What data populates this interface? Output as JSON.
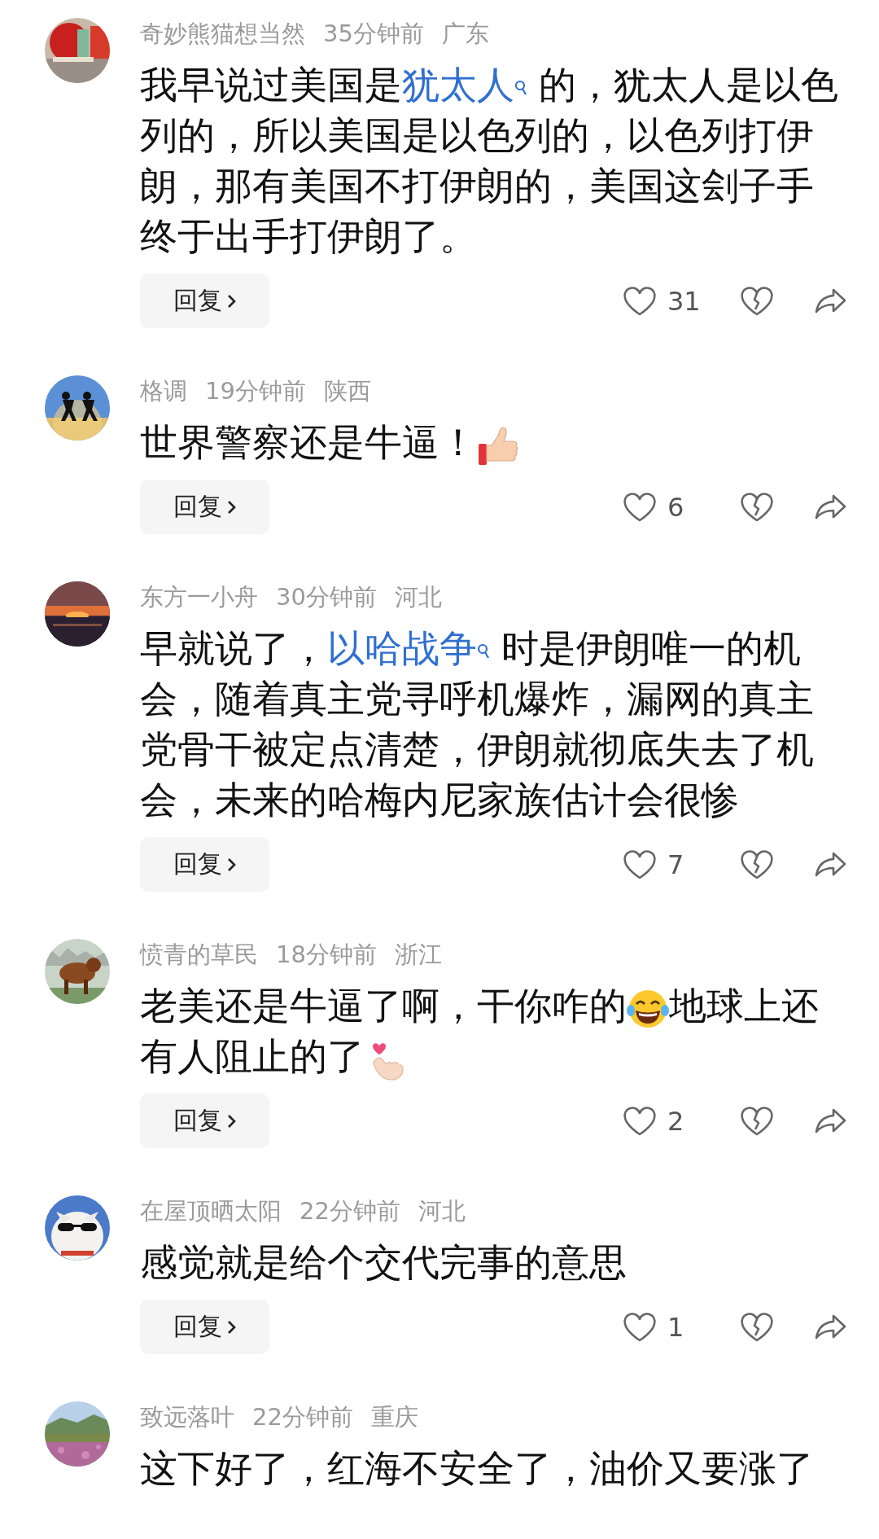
{
  "comments": [
    {
      "user": "奇妙熊猫想当然",
      "time": "35分钟前",
      "location": "广东",
      "body": [
        {
          "kind": "text",
          "text": "我早说过美国是"
        },
        {
          "kind": "link",
          "text": "犹太人"
        },
        {
          "kind": "text",
          "text": " 的，犹太人是以色列的，所以美国是以色列的，以色列打伊朗，那有美国不打伊朗的，美国这刽子手终于出手打伊朗了。"
        }
      ],
      "reply": "回复",
      "likes": "31"
    },
    {
      "user": "格调",
      "time": "19分钟前",
      "location": "陕西",
      "body": [
        {
          "kind": "text",
          "text": "世界警察还是牛逼！"
        },
        {
          "kind": "thumbsup"
        }
      ],
      "reply": "回复",
      "likes": "6"
    },
    {
      "user": "东方一小舟",
      "time": "30分钟前",
      "location": "河北",
      "body": [
        {
          "kind": "text",
          "text": "早就说了，"
        },
        {
          "kind": "link",
          "text": "以哈战争"
        },
        {
          "kind": "text",
          "text": " 时是伊朗唯一的机会，随着真主党寻呼机爆炸，漏网的真主党骨干被定点清楚，伊朗就彻底失去了机会，未来的哈梅内尼家族估计会很惨"
        }
      ],
      "reply": "回复",
      "likes": "7"
    },
    {
      "user": "愤青的草民",
      "time": "18分钟前",
      "location": "浙江",
      "body": [
        {
          "kind": "text",
          "text": "老美还是牛逼了啊，干你咋的"
        },
        {
          "kind": "laughing"
        },
        {
          "kind": "text",
          "text": "地球上还有人阻止的了"
        },
        {
          "kind": "fingerheart"
        }
      ],
      "reply": "回复",
      "likes": "2"
    },
    {
      "user": "在屋顶晒太阳",
      "time": "22分钟前",
      "location": "河北",
      "body": [
        {
          "kind": "text",
          "text": "感觉就是给个交代完事的意思"
        }
      ],
      "reply": "回复",
      "likes": "1"
    },
    {
      "user": "致远落叶",
      "time": "22分钟前",
      "location": "重庆",
      "body": [
        {
          "kind": "text",
          "text": "这下好了，红海不安全了，油价又要涨了"
        }
      ]
    }
  ]
}
